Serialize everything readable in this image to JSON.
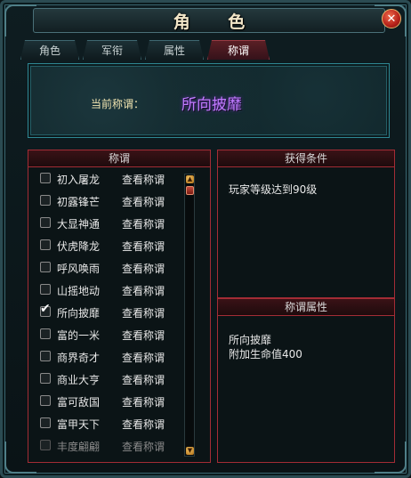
{
  "window": {
    "title": "角 色",
    "close_label": "✕"
  },
  "tabs": [
    {
      "label": "角色",
      "active": false
    },
    {
      "label": "军衔",
      "active": false
    },
    {
      "label": "属性",
      "active": false
    },
    {
      "label": "称谓",
      "active": true
    }
  ],
  "current_title": {
    "label": "当前称谓：",
    "value": "所向披靡"
  },
  "title_list": {
    "header": "称谓",
    "items": [
      {
        "name": "初入屠龙",
        "checked": false,
        "action": "查看称谓"
      },
      {
        "name": "初露锋芒",
        "checked": false,
        "action": "查看称谓"
      },
      {
        "name": "大显神通",
        "checked": false,
        "action": "查看称谓"
      },
      {
        "name": "伏虎降龙",
        "checked": false,
        "action": "查看称谓"
      },
      {
        "name": "呼风唤雨",
        "checked": false,
        "action": "查看称谓"
      },
      {
        "name": "山摇地动",
        "checked": false,
        "action": "查看称谓"
      },
      {
        "name": "所向披靡",
        "checked": true,
        "action": "查看称谓"
      },
      {
        "name": "富的一米",
        "checked": false,
        "action": "查看称谓"
      },
      {
        "name": "商界奇才",
        "checked": false,
        "action": "查看称谓"
      },
      {
        "name": "商业大亨",
        "checked": false,
        "action": "查看称谓"
      },
      {
        "name": "富可敌国",
        "checked": false,
        "action": "查看称谓"
      },
      {
        "name": "富甲天下",
        "checked": false,
        "action": "查看称谓"
      },
      {
        "name": "丰度翩翩",
        "checked": false,
        "action": "查看称谓"
      }
    ]
  },
  "conditions": {
    "header": "获得条件",
    "text": "玩家等级达到90级"
  },
  "attributes": {
    "header": "称谓属性",
    "name": "所向披靡",
    "effect": "附加生命值400"
  },
  "icons": {
    "close": "close-icon",
    "check": "checkmark-icon",
    "scroll_up": "arrow-up-icon",
    "scroll_down": "arrow-down-icon"
  },
  "colors": {
    "accent_red": "#a32c35",
    "title_purple": "#c07bff",
    "frame_teal": "#2f8894"
  }
}
